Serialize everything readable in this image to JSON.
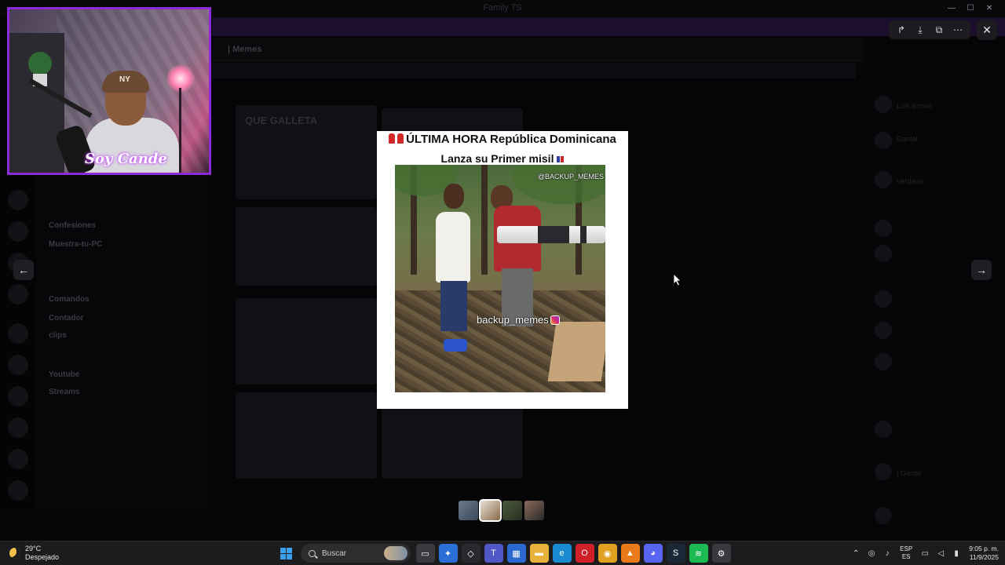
{
  "app": {
    "window_title": "Family TS"
  },
  "background": {
    "banner_text": "",
    "channel_name": "| Memes",
    "pin_text": "",
    "post_title": "QUE GALLETA",
    "channels": [
      {
        "label": "Comandos",
        "bold": true
      },
      {
        "label": "Contador",
        "bold": true
      },
      {
        "label": "clips",
        "bold": true
      },
      {
        "label": "Youtube",
        "bold": true
      },
      {
        "label": "Streams",
        "bold": true
      },
      {
        "label": "Confesiones",
        "bold": true
      },
      {
        "label": "Muestra-tu-PC",
        "bold": true
      }
    ],
    "members": [
      {
        "label": "Luis Brown"
      },
      {
        "label": "Gantal"
      },
      {
        "label": "Verdana"
      },
      {
        "label": "| Gantal"
      }
    ]
  },
  "webcam": {
    "cap_logo": "NY",
    "sign_text": "Soy Cande"
  },
  "viewer": {
    "tools": [
      {
        "icon": "forward-icon",
        "glyph": "↱"
      },
      {
        "icon": "download-icon",
        "glyph": "⤓"
      },
      {
        "icon": "open-external-icon",
        "glyph": "⧉"
      },
      {
        "icon": "more-icon",
        "glyph": "⋯"
      }
    ],
    "close_glyph": "✕",
    "prev_glyph": "←",
    "next_glyph": "→",
    "media": {
      "headline_line1": "ÚLTIMA HORA República Dominicana",
      "headline_line2": "Lanza su  Primer misil",
      "watermark_top": "@BACKUP_MEMES",
      "watermark_center": "backup_memes"
    },
    "thumbnails": [
      {
        "colors": [
          "#6a7a8a",
          "#3a4a5a"
        ]
      },
      {
        "colors": [
          "#e8e0d4",
          "#8a6a4a"
        ],
        "active": true
      },
      {
        "colors": [
          "#4a5a3a",
          "#2a2e22"
        ]
      },
      {
        "colors": [
          "#8a6a5a",
          "#2a2a2a"
        ]
      }
    ]
  },
  "taskbar": {
    "temperature": "29°C",
    "weather_desc": "Despejado",
    "search_placeholder": "Buscar",
    "lang_top": "ESP",
    "lang_bottom": "ES",
    "time": "9:05 p. m.",
    "date": "11/9/2025",
    "apps": [
      {
        "name": "task-view-icon",
        "bg": "#3a3a3e",
        "glyph": "▭"
      },
      {
        "name": "copilot-icon",
        "bg": "#2a6fd6",
        "glyph": "✦"
      },
      {
        "name": "app-icon",
        "bg": "#2a2a2e",
        "glyph": "◇"
      },
      {
        "name": "teams-icon",
        "bg": "#5058c8",
        "glyph": "T"
      },
      {
        "name": "store-icon",
        "bg": "#2a6ad0",
        "glyph": "▦"
      },
      {
        "name": "file-explorer-icon",
        "bg": "#e8b23a",
        "glyph": "▬"
      },
      {
        "name": "edge-icon",
        "bg": "#1a8ad0",
        "glyph": "e"
      },
      {
        "name": "opera-icon",
        "bg": "#d0202a",
        "glyph": "O"
      },
      {
        "name": "chrome-icon",
        "bg": "#e0a020",
        "glyph": "◉"
      },
      {
        "name": "vlc-icon",
        "bg": "#e87a1a",
        "glyph": "▲"
      },
      {
        "name": "discord-icon",
        "bg": "#5865f2",
        "glyph": "◕"
      },
      {
        "name": "steam-icon",
        "bg": "#1b2838",
        "glyph": "S"
      },
      {
        "name": "spotify-icon",
        "bg": "#1db954",
        "glyph": "≋"
      },
      {
        "name": "app-settings-icon",
        "bg": "#3a3a3e",
        "glyph": "⚙"
      }
    ]
  }
}
